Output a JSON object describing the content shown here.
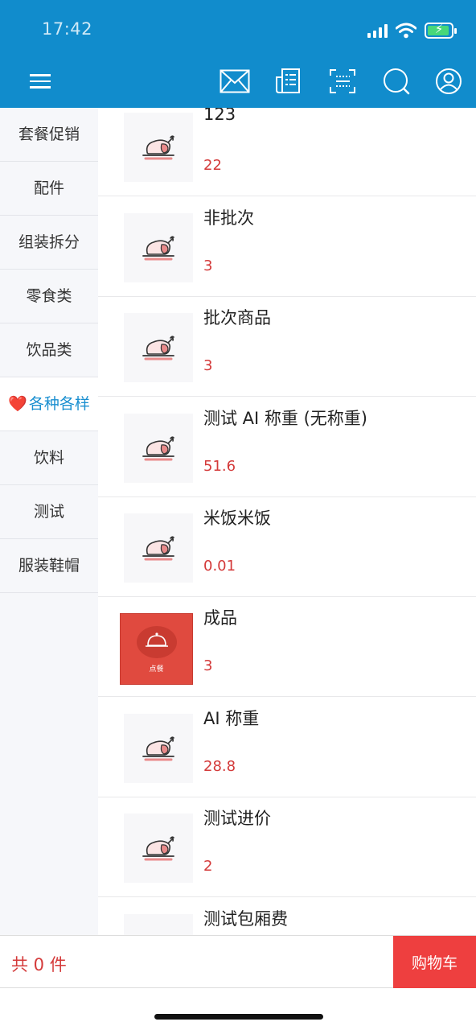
{
  "status_bar": {
    "time": "17:42"
  },
  "header": {
    "icons": [
      "menu-icon",
      "mail-icon",
      "receipt-icon",
      "barcode-scan-icon",
      "search-icon",
      "user-icon"
    ]
  },
  "sidebar": {
    "items": [
      {
        "label": "套餐促销"
      },
      {
        "label": "配件"
      },
      {
        "label": "组装拆分"
      },
      {
        "label": "零食类"
      },
      {
        "label": "饮品类"
      },
      {
        "label": "各种各样",
        "prefix": "❤️",
        "active": true
      },
      {
        "label": "饮料"
      },
      {
        "label": "测试"
      },
      {
        "label": "服装鞋帽"
      }
    ]
  },
  "products": [
    {
      "name": "123",
      "price": "22",
      "image": "roast-chicken-icon"
    },
    {
      "name": "非批次",
      "price": "3",
      "image": "roast-chicken-icon"
    },
    {
      "name": "批次商品",
      "price": "3",
      "image": "roast-chicken-icon"
    },
    {
      "name": "测试 AI 称重 (无称重)",
      "price": "51.6",
      "image": "roast-chicken-icon"
    },
    {
      "name": "米饭米饭",
      "price": "0.01",
      "image": "roast-chicken-icon"
    },
    {
      "name": "成品",
      "price": "3",
      "image": "dining-cloche-icon",
      "image_caption": "点餐"
    },
    {
      "name": "AI 称重",
      "price": "28.8",
      "image": "roast-chicken-icon"
    },
    {
      "name": "测试进价",
      "price": "2",
      "image": "roast-chicken-icon"
    },
    {
      "name": "测试包厢费",
      "price": "",
      "image": "roast-chicken-icon"
    }
  ],
  "footer": {
    "count_text": "共 0 件",
    "cart_label": "购物车"
  },
  "colors": {
    "header_bg": "#118ccc",
    "accent": "#1a8fd0",
    "price": "#d43a3a",
    "cart_button": "#ee3f3f"
  }
}
